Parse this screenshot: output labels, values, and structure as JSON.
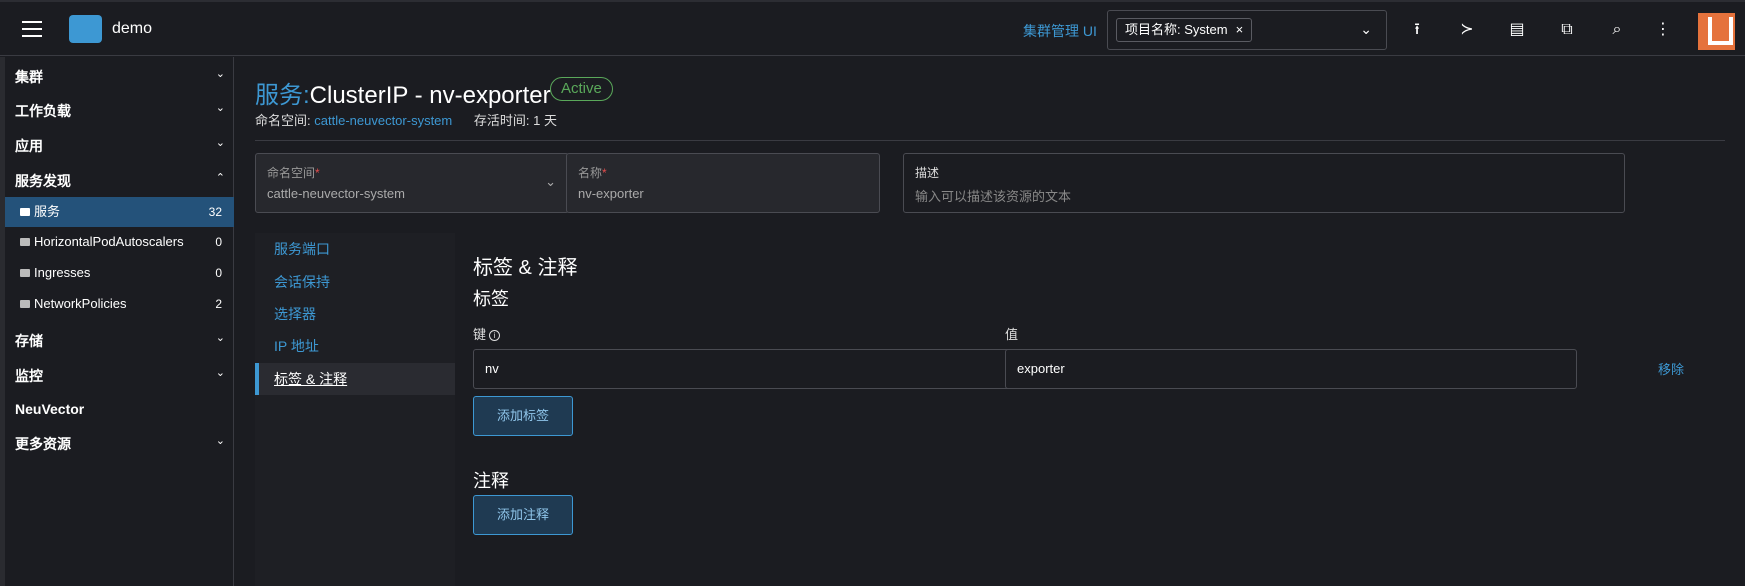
{
  "topbar": {
    "app_name": "demo",
    "cluster_link": "集群管理 UI",
    "namespace_filter_chip": "项目名称: System",
    "chip_remove": "×",
    "caret": "⌄"
  },
  "sidebar": {
    "groups": [
      {
        "label": "集群",
        "chevron": "⌄"
      },
      {
        "label": "工作负载",
        "chevron": "⌄"
      },
      {
        "label": "应用",
        "chevron": "⌄"
      },
      {
        "label": "服务发现",
        "chevron": "⌃"
      },
      {
        "label": "存储",
        "chevron": "⌄"
      },
      {
        "label": "监控",
        "chevron": "⌄"
      },
      {
        "label": "NeuVector",
        "chevron": ""
      },
      {
        "label": "更多资源",
        "chevron": "⌄"
      }
    ],
    "items": [
      {
        "label": "服务",
        "count": "32"
      },
      {
        "label": "HorizontalPodAutoscalers",
        "count": "0"
      },
      {
        "label": "Ingresses",
        "count": "0"
      },
      {
        "label": "NetworkPolicies",
        "count": "2"
      }
    ]
  },
  "header": {
    "title_prefix": "服务:",
    "title_name": "ClusterIP - nv-exporter",
    "status": "Active",
    "namespace_label": "命名空间:",
    "namespace_value": "cattle-neuvector-system",
    "age_label": "存活时间:",
    "age_value": "1 天"
  },
  "form": {
    "namespace": {
      "label": "命名空间",
      "required": "*",
      "value": "cattle-neuvector-system"
    },
    "name": {
      "label": "名称",
      "required": "*",
      "value": "nv-exporter"
    },
    "description": {
      "label": "描述",
      "placeholder": "输入可以描述该资源的文本"
    }
  },
  "tabs": [
    "服务端口",
    "会话保持",
    "选择器",
    "IP 地址",
    "标签 & 注释"
  ],
  "labels_section": {
    "heading": "标签 & 注释",
    "labels_title": "标签",
    "key_header": "键",
    "info": "i",
    "value_header": "值",
    "key_value": "nv",
    "value_value": "exporter",
    "remove": "移除",
    "add_label": "添加标签",
    "annotations_title": "注释",
    "add_annotation": "添加注释"
  },
  "colors": {
    "accent": "#3d98d3",
    "active_nav": "#24527a",
    "status_green": "#5aa85a",
    "avatar": "#e5723c"
  }
}
